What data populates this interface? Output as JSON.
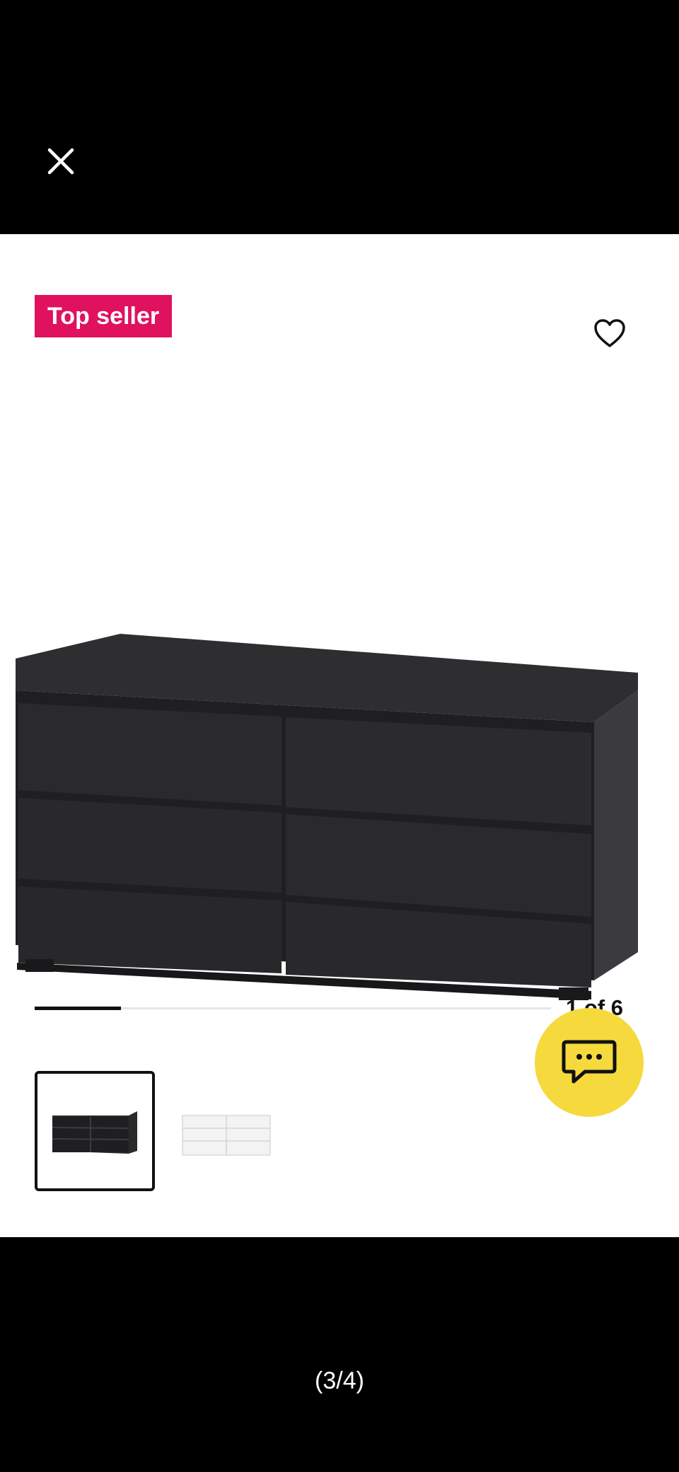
{
  "viewer": {
    "close_icon": "close-icon",
    "page_indicator": "(3/4)"
  },
  "product": {
    "badge": "Top seller",
    "favorite_icon": "heart-outline-icon",
    "chat_icon": "chat-bubble-icon",
    "image_counter": "1 of 6",
    "image_progress": 0.167,
    "colors": {
      "badge": "#e0115f",
      "chat": "#f6d93d",
      "dresser_main": "#2a2a2d",
      "dresser_white": "#f3f3f3"
    },
    "thumbnails": [
      {
        "icon": "black-dresser-thumbnail",
        "selected": true
      },
      {
        "icon": "white-dresser-thumbnail",
        "selected": false
      }
    ]
  }
}
